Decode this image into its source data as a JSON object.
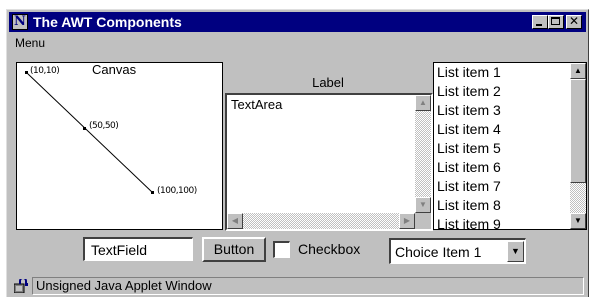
{
  "window": {
    "title": "The AWT Components",
    "icon": "java-n-icon",
    "icon_glyph": "N",
    "title_bar_color": "#000080",
    "controls": {
      "close_glyph": "✕"
    }
  },
  "menubar": {
    "items": [
      {
        "label": "Menu"
      }
    ]
  },
  "canvas": {
    "label": "Canvas",
    "points": [
      {
        "label": "(10,10)"
      },
      {
        "label": "(50,50)"
      },
      {
        "label": "(100,100)"
      }
    ]
  },
  "label_widget": {
    "text": "Label"
  },
  "textarea": {
    "value": "TextArea"
  },
  "list": {
    "items": [
      "List item 1",
      "List item 2",
      "List item 3",
      "List item 4",
      "List item 5",
      "List item 6",
      "List item 7",
      "List item 8",
      "List item 9"
    ]
  },
  "controls": {
    "textfield_value": "TextField",
    "button_label": "Button",
    "checkbox_label": "Checkbox",
    "checkbox_checked": false,
    "choice_selected": "Choice Item 1"
  },
  "status": {
    "text": "Unsigned Java Applet Window",
    "icon": "applet-warning-icon"
  },
  "icons": {
    "up": "▲",
    "down": "▼",
    "left": "◀",
    "right": "▶"
  }
}
